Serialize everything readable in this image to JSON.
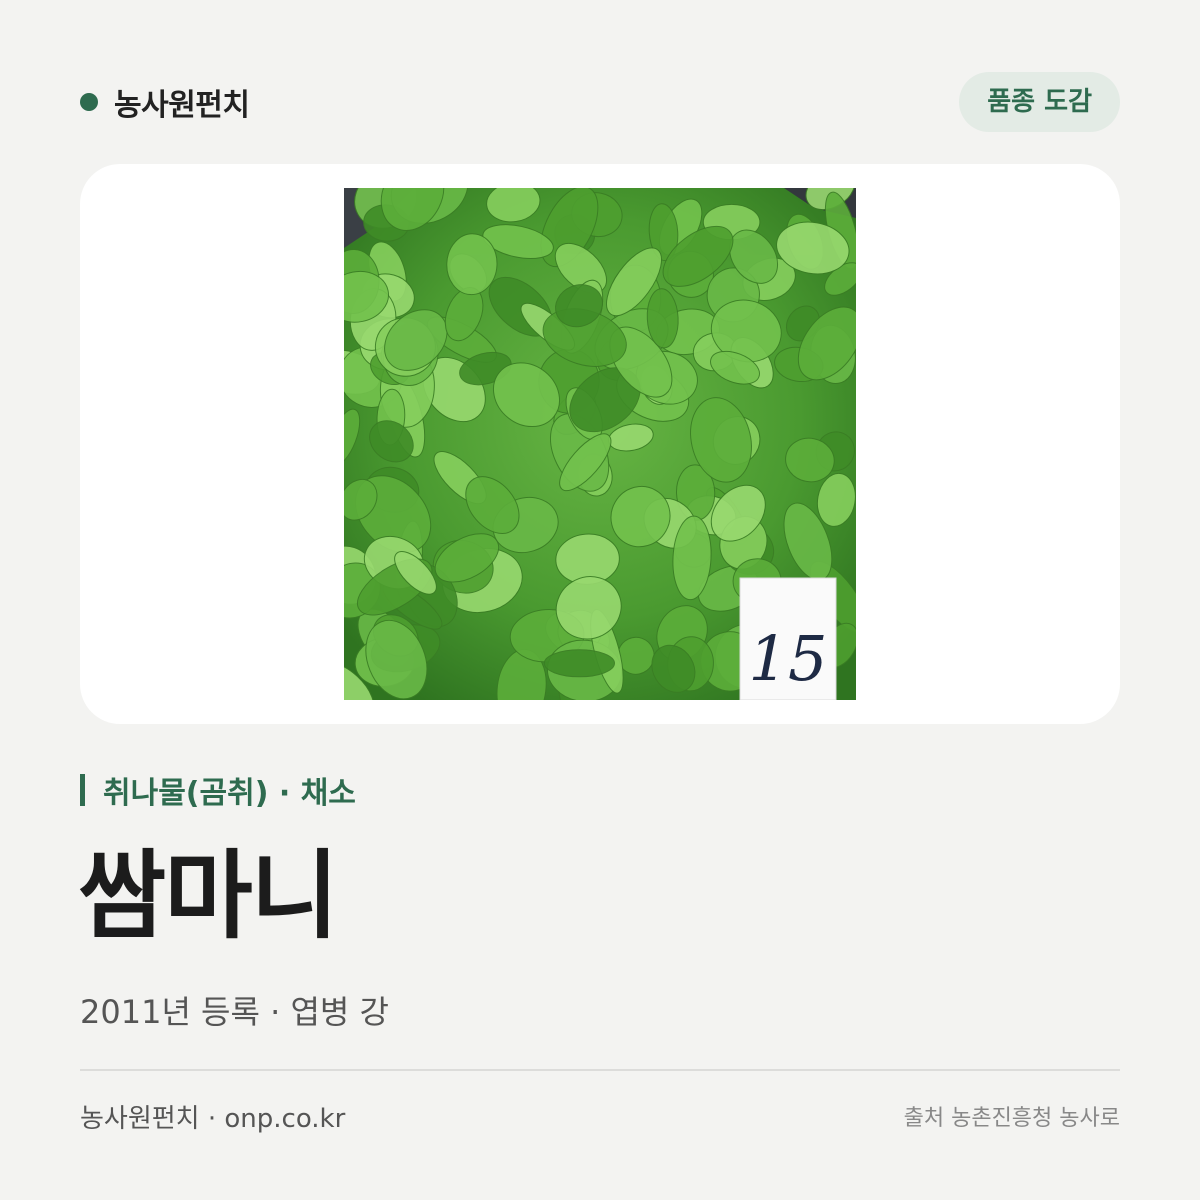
{
  "header": {
    "brand_name": "농사원펀치",
    "badge_label": "품종 도감"
  },
  "photo": {
    "description": "",
    "tag_label": "15"
  },
  "variety": {
    "category": "취나물(곰취) · 채소",
    "name": "쌈마니",
    "meta": "2011년 등록 · 엽병 강"
  },
  "footer": {
    "site": "농사원펀치 · onp.co.kr",
    "source": "출처 농촌진흥청 농사로"
  },
  "colors": {
    "accent": "#2e6b4f",
    "background": "#f3f3f1",
    "badge_bg": "#e3ebe5"
  }
}
